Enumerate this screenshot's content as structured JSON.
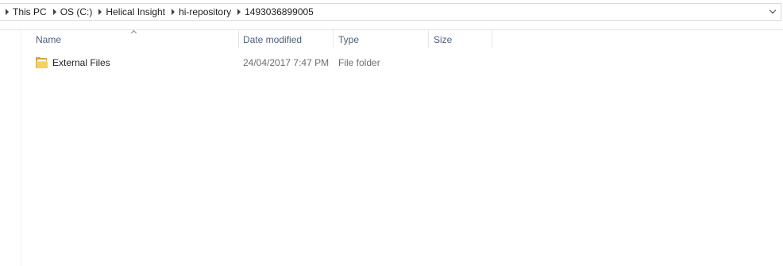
{
  "address_bar": {
    "crumbs": [
      "This PC",
      "OS (C:)",
      "Helical Insight",
      "hi-repository",
      "1493036899005"
    ],
    "dropdown_icon": "chevron-down-icon"
  },
  "columns": {
    "name": "Name",
    "date_modified": "Date modified",
    "type": "Type",
    "size": "Size",
    "sorted_by": "Name",
    "sort_direction": "ascending"
  },
  "files": [
    {
      "name": "External Files",
      "date_modified": "24/04/2017 7:47 PM",
      "type": "File folder",
      "size": "",
      "icon": "folder-icon"
    }
  ],
  "colors": {
    "header_text": "#4c607a",
    "folder": "#f3cf6b",
    "secondary_text": "#6d6d6d"
  }
}
